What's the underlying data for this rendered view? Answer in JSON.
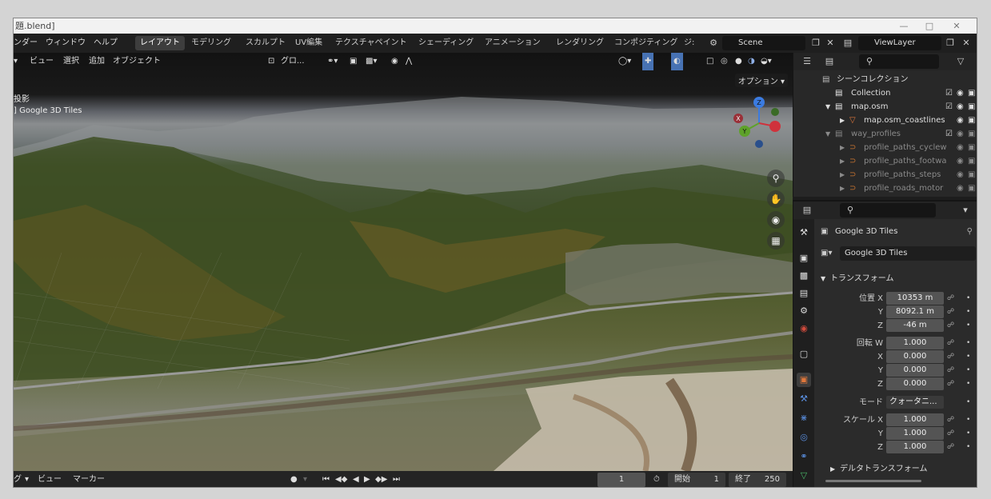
{
  "window": {
    "title": "題.blend]"
  },
  "menubar": {
    "menus": [
      "ンダー",
      "ウィンドウ",
      "ヘルプ"
    ],
    "workspaces": [
      "レイアウト",
      "モデリング",
      "スカルプト",
      "UV編集",
      "テクスチャペイント",
      "シェーディング",
      "アニメーション",
      "レンダリング",
      "コンポジティング",
      "ジ:"
    ],
    "scene": "Scene",
    "view_layer": "ViewLayer"
  },
  "viewport": {
    "menus": [
      "ビュー",
      "選択",
      "追加",
      "オブジェクト"
    ],
    "transform_orientation": "グロ...",
    "options": "オプション",
    "overlay_line1": "投影",
    "overlay_line2": "] Google 3D Tiles",
    "gizmo": {
      "x": "X",
      "y": "Y",
      "z": "Z"
    }
  },
  "timeline": {
    "menus": [
      "グ",
      "ビュー",
      "マーカー"
    ],
    "current_frame": "1",
    "start_label": "開始",
    "start": "1",
    "end_label": "終了",
    "end": "250"
  },
  "outliner": {
    "scene_collection": "シーンコレクション",
    "items": [
      {
        "label": "Collection"
      },
      {
        "label": "map.osm"
      },
      {
        "label": "map.osm_coastlines"
      },
      {
        "label": "way_profiles"
      },
      {
        "label": "profile_paths_cyclew"
      },
      {
        "label": "profile_paths_footwa"
      },
      {
        "label": "profile_paths_steps"
      },
      {
        "label": "profile_roads_motor"
      }
    ]
  },
  "properties": {
    "header_object": "Google 3D Tiles",
    "object_name": "Google 3D Tiles",
    "transform_panel": "トランスフォーム",
    "location_label": "位置 X",
    "location": {
      "x": "10353 m",
      "y": "8092.1 m",
      "z": "-46 m"
    },
    "rotation_label": "回転 W",
    "rotation": {
      "w": "1.000",
      "x": "0.000",
      "y": "0.000",
      "z": "0.000"
    },
    "mode_label": "モード",
    "mode": "クォータニ...",
    "scale_label": "スケール X",
    "scale": {
      "x": "1.000",
      "y": "1.000",
      "z": "1.000"
    },
    "delta_panel": "デルタトランスフォーム",
    "axis": {
      "y": "Y",
      "z": "Z",
      "x": "X"
    }
  },
  "colors": {
    "accent": "#4772b3",
    "active_tab": "#e0773b",
    "header": "#1f1f1f",
    "panel": "#2b2b2b"
  }
}
